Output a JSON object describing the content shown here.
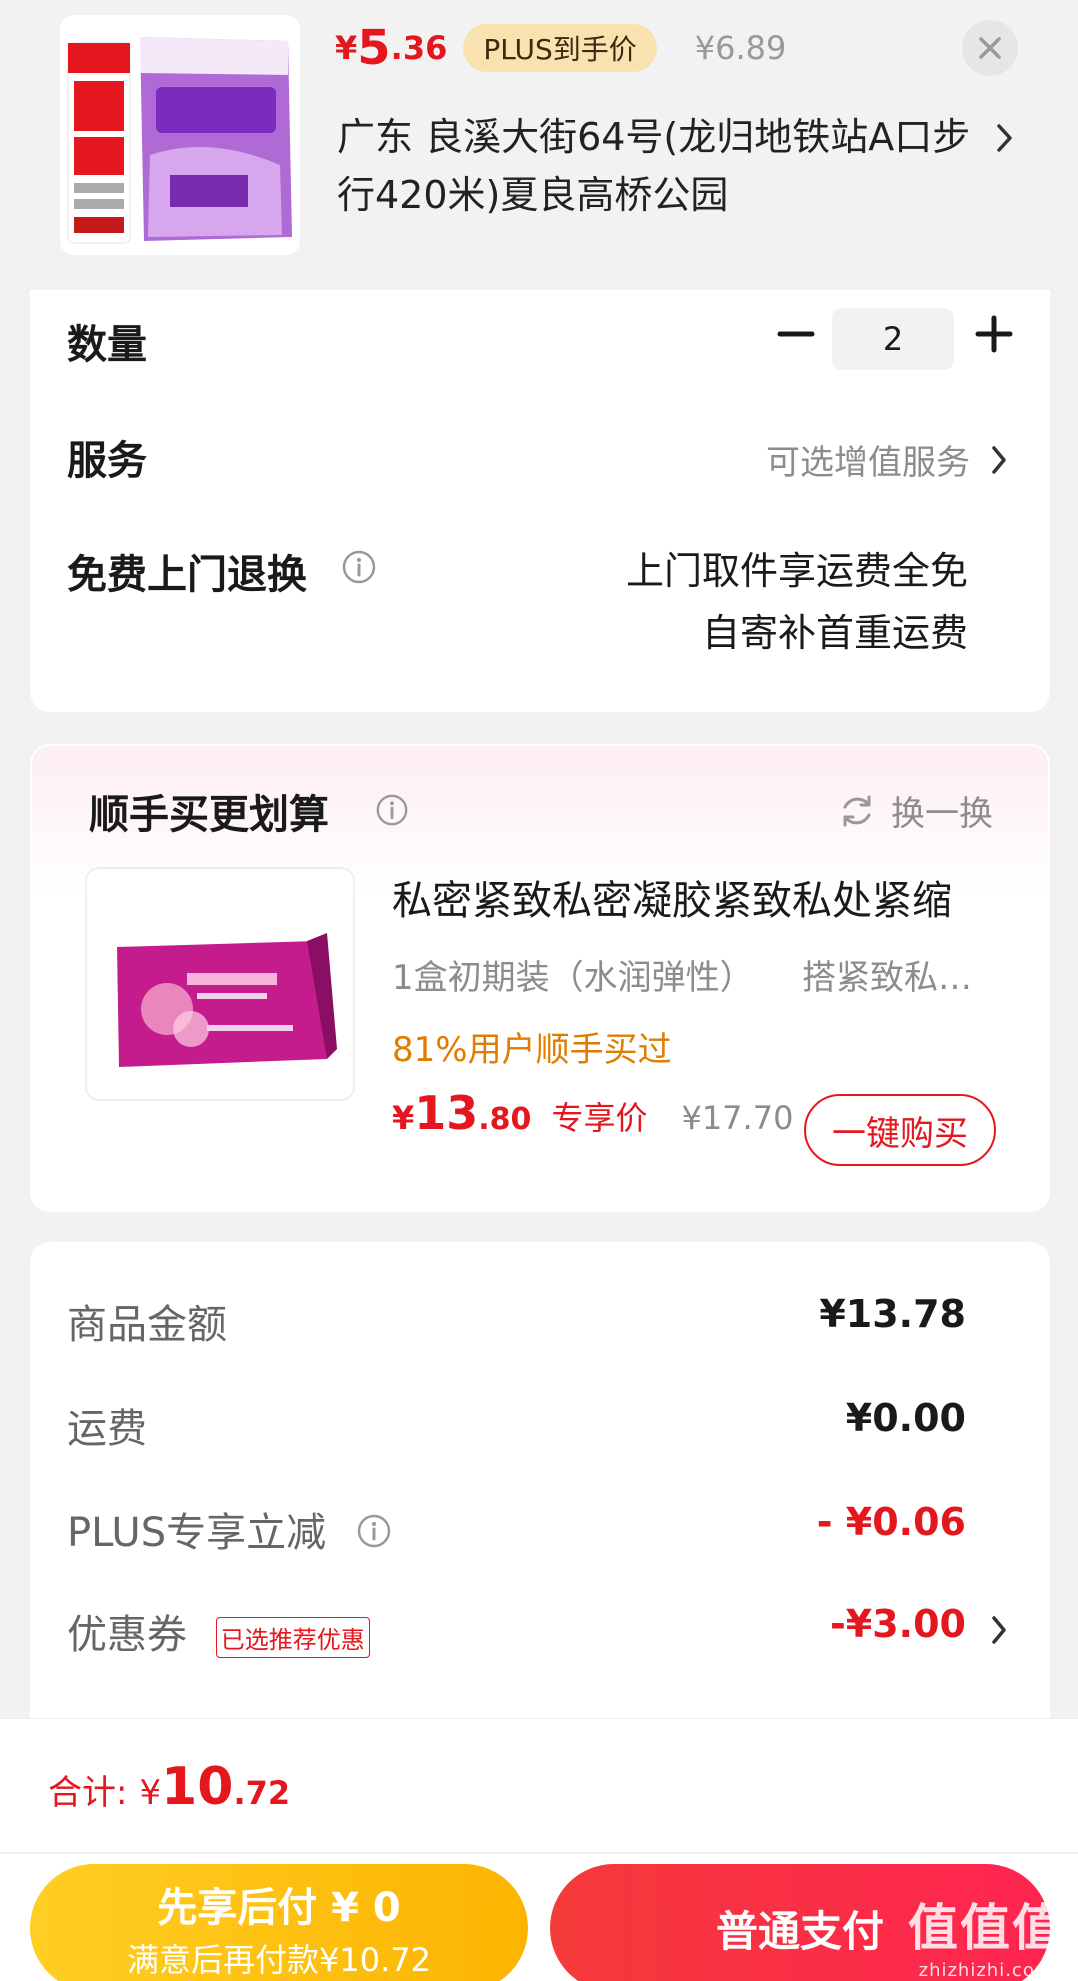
{
  "header": {
    "price_currency": "¥",
    "price_int": "5",
    "price_dec": ".36",
    "plus_badge": "PLUS到手价",
    "original_price": "¥6.89",
    "address": "广东  良溪大街64号(龙归地铁站A口步行420米)夏良高桥公园",
    "close_icon": "close-icon",
    "chevron_icon": "chevron-right-icon"
  },
  "order": {
    "quantity_label": "数量",
    "quantity_value": "2",
    "service_label": "服务",
    "service_value": "可选增值服务",
    "return_label": "免费上门退换",
    "return_desc_line1": "上门取件享运费全免",
    "return_desc_line2": "自寄补首重运费"
  },
  "upsell": {
    "title": "顺手买更划算",
    "swap_label": "换一换",
    "product_name": "私密紧致私密凝胶紧致私处紧缩",
    "spec": "1盒初期装（水润弹性）",
    "spec_extra": "搭紧致私…",
    "social_proof": "81%用户顺手买过",
    "price_currency": "¥",
    "price_int": "13",
    "price_dec": ".80",
    "price_tag": "专享价",
    "original_price": "¥17.70",
    "buy_button": "一键购买"
  },
  "fees": {
    "goods_label": "商品金额",
    "goods_value": "¥13.78",
    "shipping_label": "运费",
    "shipping_value": "¥0.00",
    "plus_label": "PLUS专享立减",
    "plus_value": "- ¥0.06",
    "coupon_label": "优惠券",
    "coupon_tag": "已选推荐优惠",
    "coupon_value": "-¥3.00"
  },
  "footer": {
    "total_label": "合计:",
    "total_currency": "¥",
    "total_int": "10",
    "total_dec": ".72",
    "pay_later_title": "先享后付 ¥ 0",
    "pay_later_sub": "满意后再付款¥10.72",
    "pay_now": "普通支付",
    "watermark_main": "值值值",
    "watermark_sub": "zhizhizhi.com"
  },
  "colors": {
    "accent_red": "#e4161e",
    "plus_gold": "#f8e3b0",
    "pay_later_yellow": "#fcb400",
    "social_orange": "#e07d00"
  }
}
